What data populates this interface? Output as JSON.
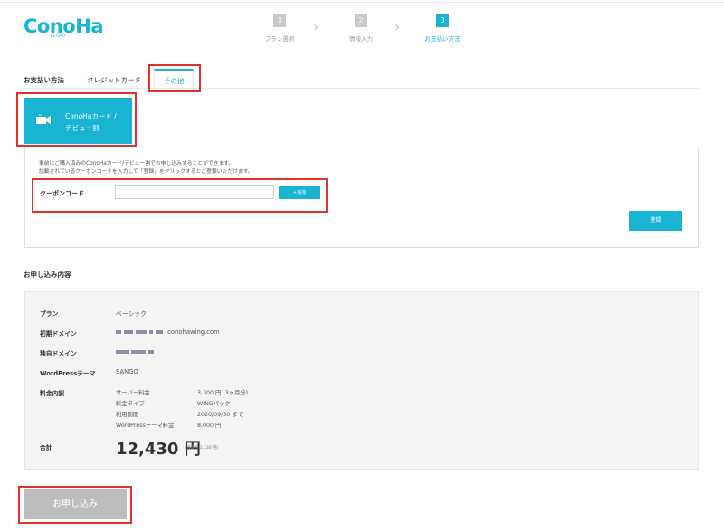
{
  "brand": {
    "name": "ConoHa",
    "sub": "by GMO"
  },
  "steps": [
    {
      "num": "1",
      "label": "プラン選択"
    },
    {
      "num": "2",
      "label": "情報入力"
    },
    {
      "num": "3",
      "label": "お支払い方法"
    }
  ],
  "tabs": {
    "heading": "お支払い方法",
    "credit": "クレジットカード",
    "other": "その他"
  },
  "card_button": {
    "line1": "ConoHaカード /",
    "line2": "デビュー割"
  },
  "coupon": {
    "note_line1": "事前にご購入済みのConoHaカード/デビュー割でお申し込みすることができます。",
    "note_line2": "記載されているクーポンコードを入力して「登録」をクリックするとご登録いただけます。",
    "label": "クーポンコード",
    "input_value": "",
    "add_label": "+追加",
    "register_label": "登録"
  },
  "summary": {
    "title": "お申し込み内容",
    "plan_label": "プラン",
    "plan_value": "ベーシック",
    "domain_label": "初期ドメイン",
    "domain_suffix": ".conohawing.com",
    "own_domain_label": "独自ドメイン",
    "wp_label": "WordPressテーマ",
    "wp_value": "SANGO",
    "fee_label": "料金内訳",
    "fees": [
      {
        "name": "サーバー料金",
        "value": "3,300 円 (3ヶ月分)"
      },
      {
        "name": "料金タイプ",
        "value": "WINGパック"
      },
      {
        "name": "利用期間",
        "value": "2020/09/30 まで"
      },
      {
        "name": "WordPressテーマ料金",
        "value": "8,000 円"
      }
    ],
    "total_label": "合計",
    "total_value": "12,430 円",
    "tax_note": "(消費税 1,130 円)"
  },
  "submit_label": "お申し込み"
}
